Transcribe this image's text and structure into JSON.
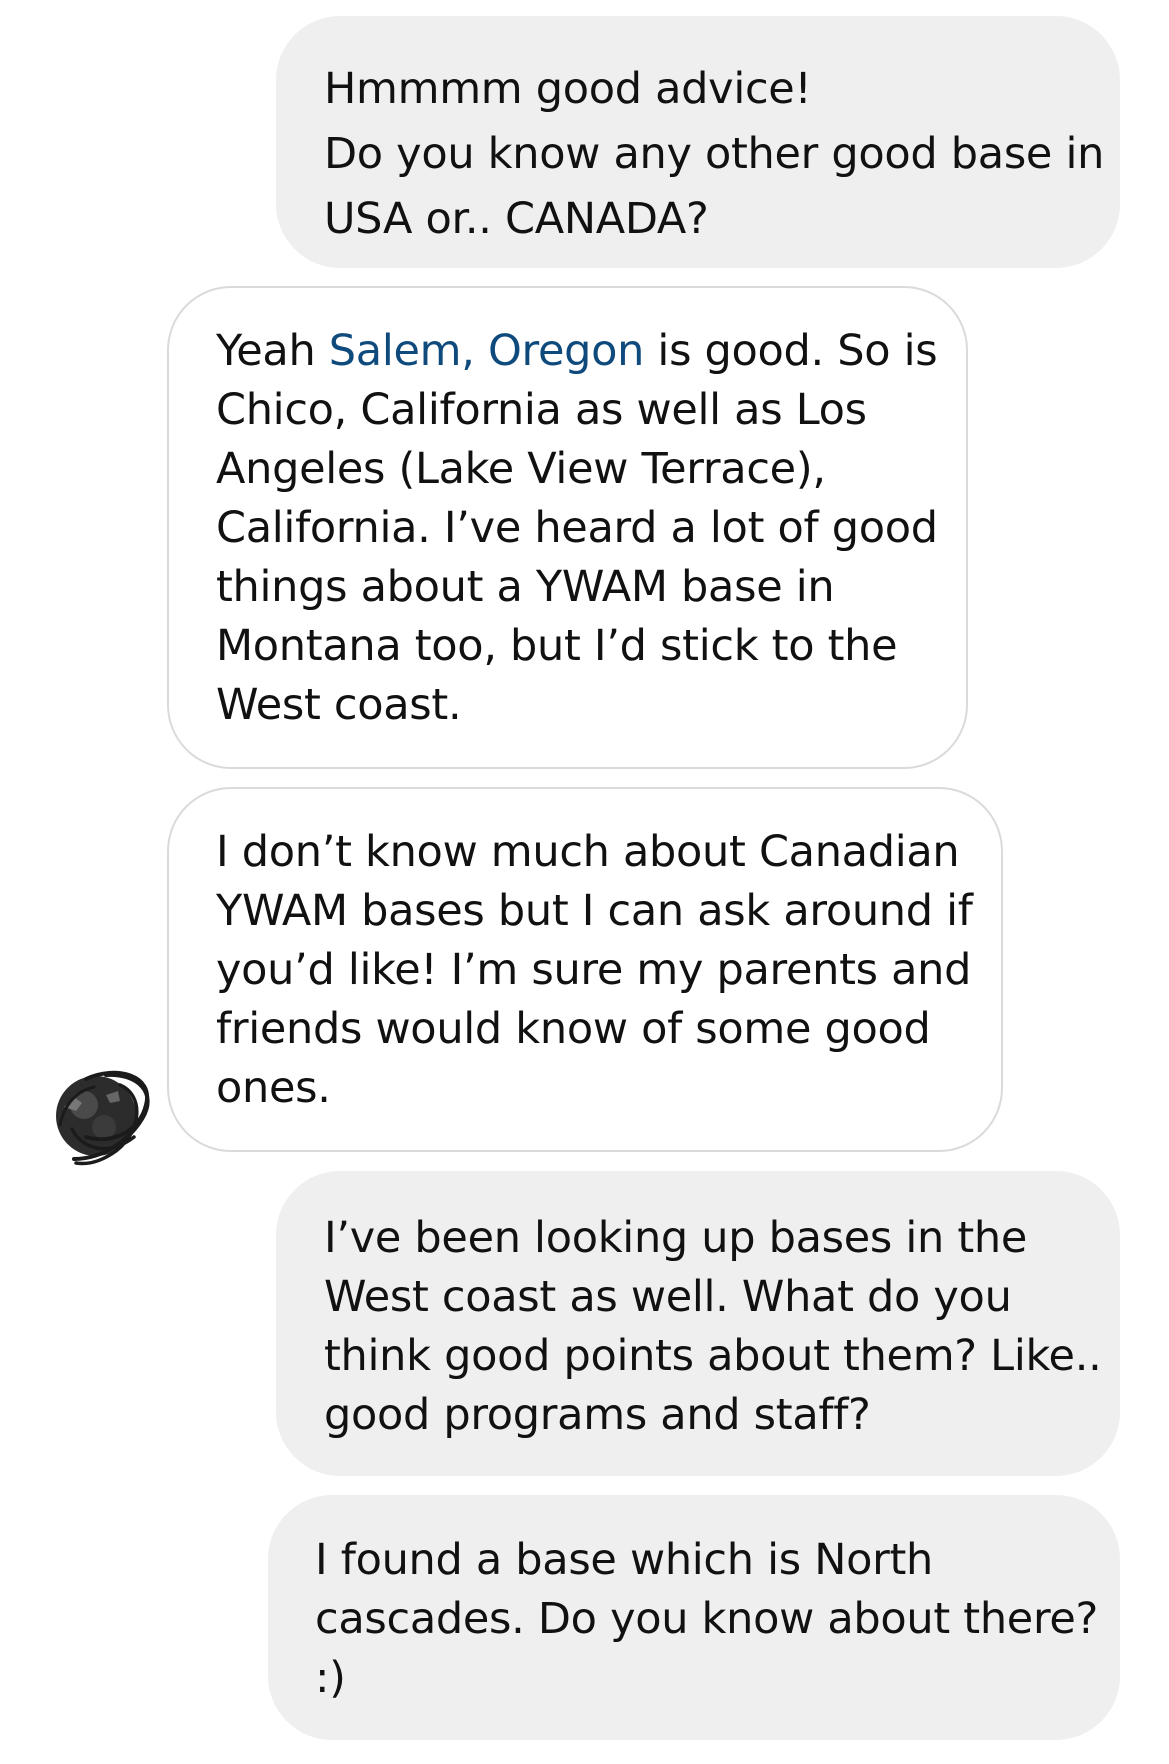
{
  "messages": [
    {
      "from": "me",
      "lines": [
        "Hmmmm good advice!",
        "Do you know any other good base in",
        "USA or.. CANADA?"
      ]
    },
    {
      "from": "them",
      "line1_prefix": "Yeah ",
      "line1_link": "Salem, Oregon",
      "line1_suffix": " is good. So is",
      "lines": [
        "Chico, California as well as Los",
        "Angeles (Lake View Terrace),",
        "California. I’ve heard a lot of good",
        "things about a YWAM base in",
        "Montana too, but I’d stick to the",
        "West coast."
      ]
    },
    {
      "from": "them",
      "lines": [
        "I don’t know much about Canadian",
        "YWAM bases but I can ask around if",
        "you’d like! I’m sure my parents and",
        "friends would know of some good",
        "ones."
      ]
    },
    {
      "from": "me",
      "lines": [
        "I’ve been looking up bases in the",
        "West coast as well. What do you",
        "think good points about them? Like..",
        "good programs and staff?"
      ]
    },
    {
      "from": "me",
      "lines": [
        "I found a base which is North",
        "cascades. Do you know about there?",
        ":)"
      ]
    }
  ],
  "colors": {
    "sent_bubble": "#efefef",
    "received_border": "#dadada",
    "link": "#0f4a7d",
    "text": "#111111"
  },
  "avatar": {
    "icon": "scribbled-profile-avatar-icon"
  }
}
